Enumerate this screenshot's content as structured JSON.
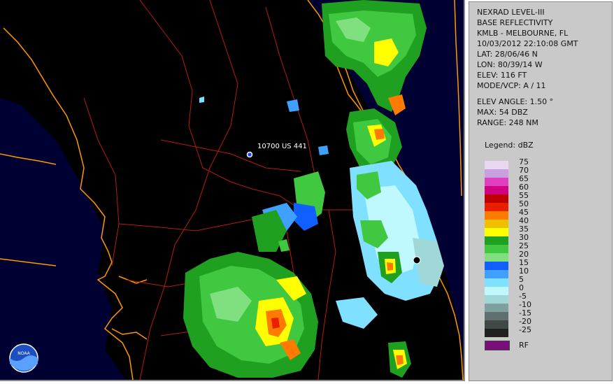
{
  "panel": {
    "title": "NEXRAD LEVEL-III",
    "product": "BASE REFLECTIVITY",
    "station": "KMLB - MELBOURNE, FL",
    "datetime": "10/03/2012 22:10:08 GMT",
    "lat": "LAT: 28/06/46 N",
    "lon": "LON: 80/39/14 W",
    "elev": "ELEV: 116 FT",
    "mode": "MODE/VCP: A / 11",
    "elev_angle": "ELEV ANGLE: 1.50 °",
    "max": "MAX: 54 DBZ",
    "range": "RANGE: 248 NM",
    "legend_title": "Legend: dBZ",
    "rf_label": "RF"
  },
  "legend": [
    {
      "label": "75",
      "color": "#e8d8f0"
    },
    {
      "label": "70",
      "color": "#c8a0e0"
    },
    {
      "label": "65",
      "color": "#e040c0"
    },
    {
      "label": "60",
      "color": "#d00080"
    },
    {
      "label": "55",
      "color": "#c00000"
    },
    {
      "label": "50",
      "color": "#e82000"
    },
    {
      "label": "45",
      "color": "#ff7a00"
    },
    {
      "label": "40",
      "color": "#f0c000"
    },
    {
      "label": "35",
      "color": "#ffff00"
    },
    {
      "label": "30",
      "color": "#20a020"
    },
    {
      "label": "25",
      "color": "#40c840"
    },
    {
      "label": "20",
      "color": "#80e080"
    },
    {
      "label": "15",
      "color": "#1060ff"
    },
    {
      "label": "10",
      "color": "#40a0ff"
    },
    {
      "label": "5",
      "color": "#80e0ff"
    },
    {
      "label": "0",
      "color": "#c0f8ff"
    },
    {
      "label": "-5",
      "color": "#a0d8d8"
    },
    {
      "label": "-10",
      "color": "#80a0a0"
    },
    {
      "label": "-15",
      "color": "#607070"
    },
    {
      "label": "-20",
      "color": "#404848"
    },
    {
      "label": "-25",
      "color": "#202020"
    }
  ],
  "map": {
    "location_label": "10700 US 441",
    "logo_text": "NOAA",
    "colors": {
      "ocean": "#000033",
      "land": "#000000",
      "coast": "#ff9900",
      "roads": "#cc2200"
    }
  }
}
